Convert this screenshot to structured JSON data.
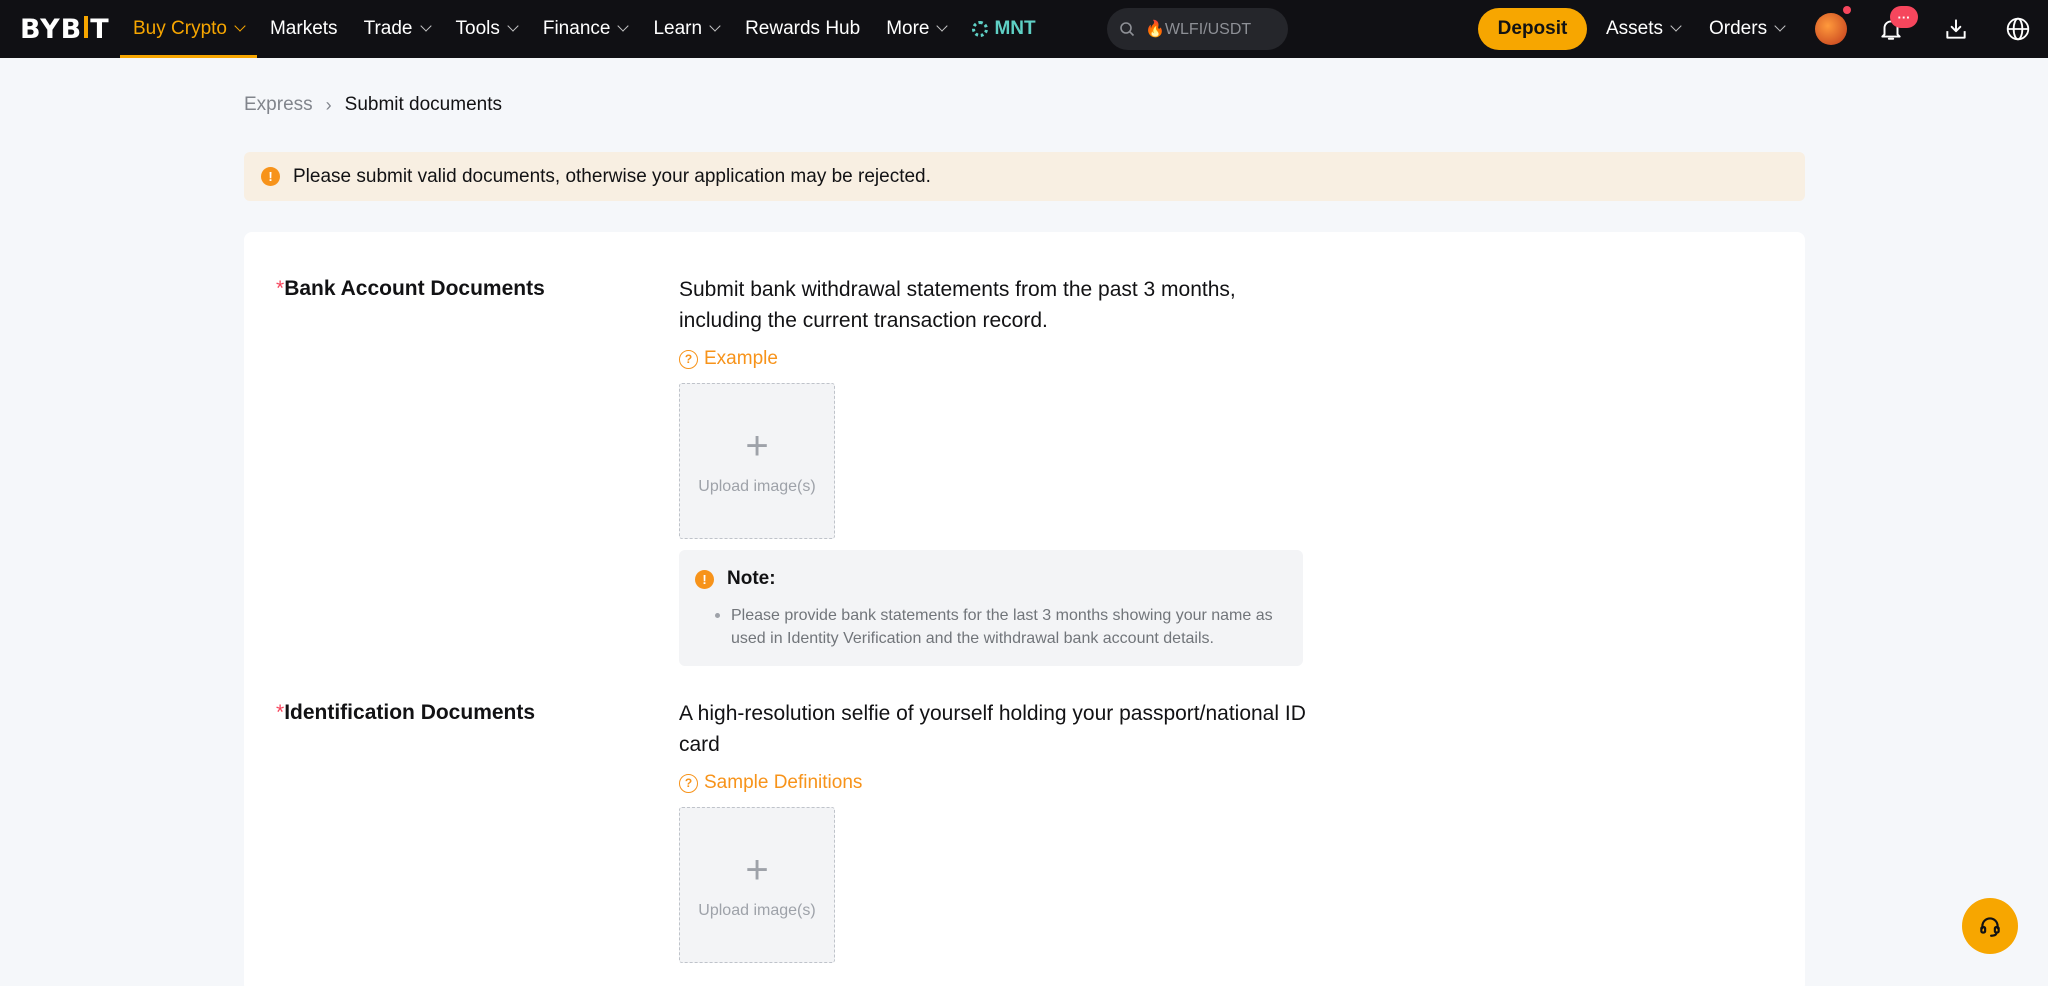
{
  "nav": {
    "logo_left": "BYB",
    "logo_right": "T",
    "items": [
      {
        "label": "Buy Crypto",
        "dropdown": true,
        "active": true
      },
      {
        "label": "Markets",
        "dropdown": false
      },
      {
        "label": "Trade",
        "dropdown": true
      },
      {
        "label": "Tools",
        "dropdown": true
      },
      {
        "label": "Finance",
        "dropdown": true
      },
      {
        "label": "Learn",
        "dropdown": true
      },
      {
        "label": "Rewards Hub",
        "dropdown": false
      },
      {
        "label": "More",
        "dropdown": true
      }
    ],
    "mnt_label": "MNT",
    "search_text": "🔥WLFI/USDT",
    "deposit_label": "Deposit",
    "assets_label": "Assets",
    "orders_label": "Orders",
    "notification_badge": "···"
  },
  "breadcrumb": {
    "parent": "Express",
    "current": "Submit documents"
  },
  "alert": {
    "icon": "!",
    "text": "Please submit valid documents, otherwise your application may be rejected."
  },
  "sections": {
    "bank": {
      "required_mark": "*",
      "title": "Bank Account Documents",
      "description": "Submit bank withdrawal statements from the past 3 months, including the current transaction record.",
      "help_link": "Example",
      "upload_label": "Upload image(s)",
      "note_title": "Note:",
      "note_items": [
        "Please provide bank statements for the last 3 months showing your name as used in Identity Verification and the withdrawal bank account details."
      ]
    },
    "identification": {
      "required_mark": "*",
      "title": "Identification Documents",
      "description": "A high-resolution selfie of yourself holding your passport/national ID card",
      "help_link": "Sample Definitions",
      "upload_label": "Upload image(s)"
    }
  },
  "colors": {
    "accent": "#f7a600",
    "warning": "#f7931a",
    "required": "#f6465d",
    "nav_bg": "#101014"
  },
  "icons": [
    "search-icon",
    "bell-icon",
    "download-icon",
    "globe-icon",
    "headset-icon",
    "warning-icon",
    "question-icon",
    "plus-icon",
    "chevron-down-icon"
  ]
}
